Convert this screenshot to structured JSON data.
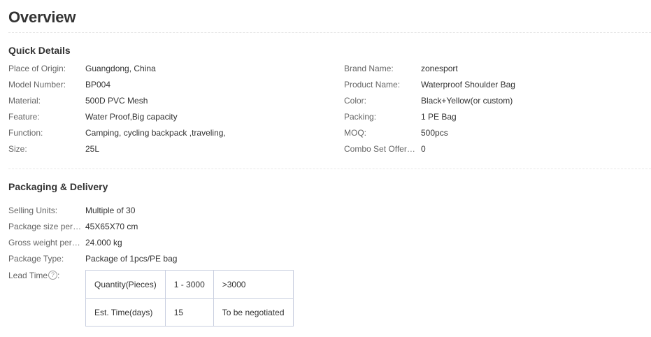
{
  "page": {
    "title": "Overview"
  },
  "quick_details": {
    "heading": "Quick Details",
    "left": [
      {
        "label": "Place of Origin:",
        "value": "Guangdong, China"
      },
      {
        "label": "Model Number:",
        "value": "BP004"
      },
      {
        "label": "Material:",
        "value": "500D PVC Mesh"
      },
      {
        "label": "Feature:",
        "value": "Water Proof,Big capacity"
      },
      {
        "label": "Function:",
        "value": "Camping, cycling backpack ,traveling,"
      },
      {
        "label": "Size:",
        "value": "25L"
      }
    ],
    "right": [
      {
        "label": "Brand Name:",
        "value": "zonesport"
      },
      {
        "label": "Product Name:",
        "value": "Waterproof Shoulder Bag"
      },
      {
        "label": "Color:",
        "value": "Black+Yellow(or custom)"
      },
      {
        "label": "Packing:",
        "value": "1 PE Bag"
      },
      {
        "label": "MOQ:",
        "value": "500pcs"
      },
      {
        "label": "Combo Set Offered:",
        "value": "0"
      }
    ]
  },
  "packaging": {
    "heading": "Packaging & Delivery",
    "rows": [
      {
        "label": "Selling Units:",
        "value": "Multiple of 30"
      },
      {
        "label": "Package size per b...",
        "value": "45X65X70 cm"
      },
      {
        "label": "Gross weight per b...",
        "value": "24.000 kg"
      },
      {
        "label": "Package Type:",
        "value": "Package of 1pcs/PE bag"
      }
    ],
    "lead_time": {
      "label": "Lead Time",
      "help_icon": "question-circle-icon",
      "help_glyph": "?",
      "colon": ":",
      "table": [
        [
          "Quantity(Pieces)",
          "1 - 3000",
          ">3000"
        ],
        [
          "Est. Time(days)",
          "15",
          "To be negotiated"
        ]
      ]
    }
  },
  "colors": {
    "text": "#333333",
    "label": "#666666",
    "table_border": "#c9cfe0",
    "divider": "#e8e8e8"
  }
}
